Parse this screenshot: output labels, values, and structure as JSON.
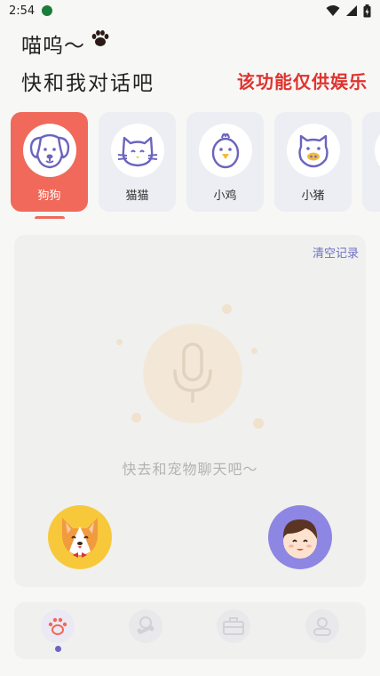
{
  "status_bar": {
    "time": "2:54"
  },
  "header": {
    "greeting": "喵呜～",
    "subtitle": "快和我对话吧",
    "disclaimer": "该功能仅供娱乐"
  },
  "pets": [
    {
      "label": "狗狗",
      "icon": "dog-icon",
      "active": true
    },
    {
      "label": "猫猫",
      "icon": "cat-icon",
      "active": false
    },
    {
      "label": "小鸡",
      "icon": "chick-icon",
      "active": false
    },
    {
      "label": "小猪",
      "icon": "pig-icon",
      "active": false
    }
  ],
  "chat": {
    "clear_label": "清空记录",
    "hint": "快去和宠物聊天吧～",
    "pet_avatar_icon": "corgi-avatar-icon",
    "user_avatar_icon": "user-avatar-icon"
  },
  "tabs": [
    {
      "icon": "paw-icon",
      "active": true
    },
    {
      "icon": "bone-icon",
      "active": false
    },
    {
      "icon": "briefcase-icon",
      "active": false
    },
    {
      "icon": "profile-icon",
      "active": false
    }
  ],
  "colors": {
    "accent": "#f0695a",
    "link": "#6c71c4",
    "warning": "#e0332e",
    "icon_stroke": "#6b64bf"
  }
}
